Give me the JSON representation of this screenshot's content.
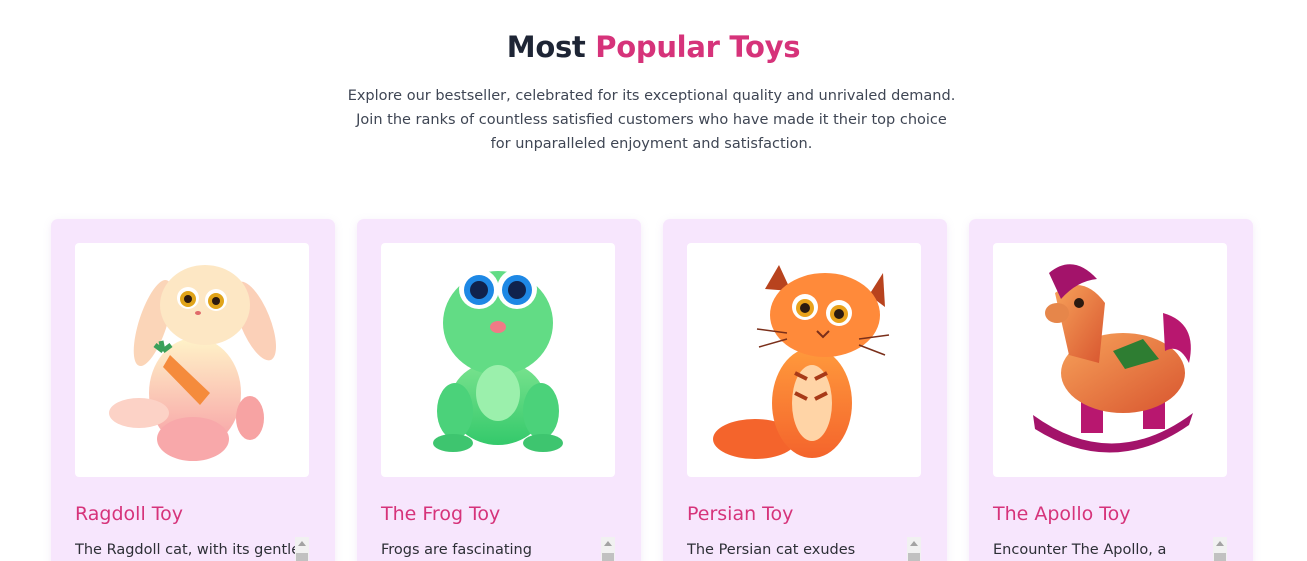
{
  "section": {
    "heading_prefix": "Most",
    "heading_accent": "Popular Toys",
    "subtitle_lines": [
      "Explore our bestseller, celebrated for its exceptional quality and unrivaled demand.",
      "Join the ranks of countless satisfied customers who have made it their top choice",
      "for unparalleled enjoyment and satisfaction."
    ]
  },
  "colors": {
    "accent": "#d6337a",
    "heading": "#1e2535",
    "card_background": "#f7e6fd"
  },
  "products": [
    {
      "title": "Ragdoll Toy",
      "description": "The Ragdoll cat, with its gentle",
      "image_icon": "bunny-toy-illustration"
    },
    {
      "title": "The Frog Toy",
      "description": "Frogs are fascinating",
      "image_icon": "frog-toy-illustration"
    },
    {
      "title": "Persian Toy",
      "description": "The Persian cat exudes",
      "image_icon": "tiger-cat-toy-illustration"
    },
    {
      "title": "The Apollo Toy",
      "description": "Encounter The Apollo, a",
      "image_icon": "rocking-horse-toy-illustration"
    }
  ]
}
